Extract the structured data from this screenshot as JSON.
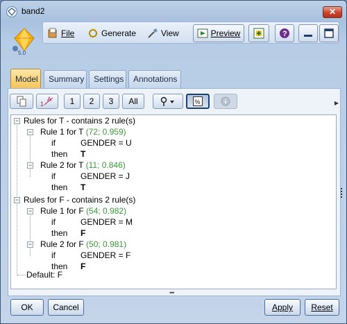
{
  "window": {
    "title": "band2"
  },
  "toolbar": {
    "file_label": "File",
    "generate_label": "Generate",
    "view_label": "View",
    "preview_label": "Preview",
    "node_badge": "5.0"
  },
  "tabs": [
    "Model",
    "Summary",
    "Settings",
    "Annotations"
  ],
  "iconbar": {
    "b1": "1",
    "b2": "2",
    "b3": "3",
    "all": "All"
  },
  "tree": {
    "groupT": "Rules for T - contains 2 rule(s)",
    "t1_head": "Rule 1 for  T",
    "t1_stats": "(72; 0.959)",
    "t1_if": "if",
    "t1_cond": "GENDER = U",
    "t1_then": "then",
    "t1_val": "T",
    "t2_head": "Rule 2 for  T",
    "t2_stats": "(11; 0.846)",
    "t2_if": "if",
    "t2_cond": "GENDER = J",
    "t2_then": "then",
    "t2_val": "T",
    "groupF": "Rules for F - contains 2 rule(s)",
    "f1_head": "Rule 1 for  F",
    "f1_stats": "(54; 0.982)",
    "f1_if": "if",
    "f1_cond": "GENDER = M",
    "f1_then": "then",
    "f1_val": "F",
    "f2_head": "Rule 2 for  F",
    "f2_stats": "(50; 0.981)",
    "f2_if": "if",
    "f2_cond": "GENDER = F",
    "f2_then": "then",
    "f2_val": "F",
    "default": "Default: F"
  },
  "buttons": {
    "ok": "OK",
    "cancel": "Cancel",
    "apply": "Apply",
    "reset": "Reset"
  },
  "colors": {
    "stats_green": "#3a9a3a",
    "active_tab": "#f6c458"
  }
}
